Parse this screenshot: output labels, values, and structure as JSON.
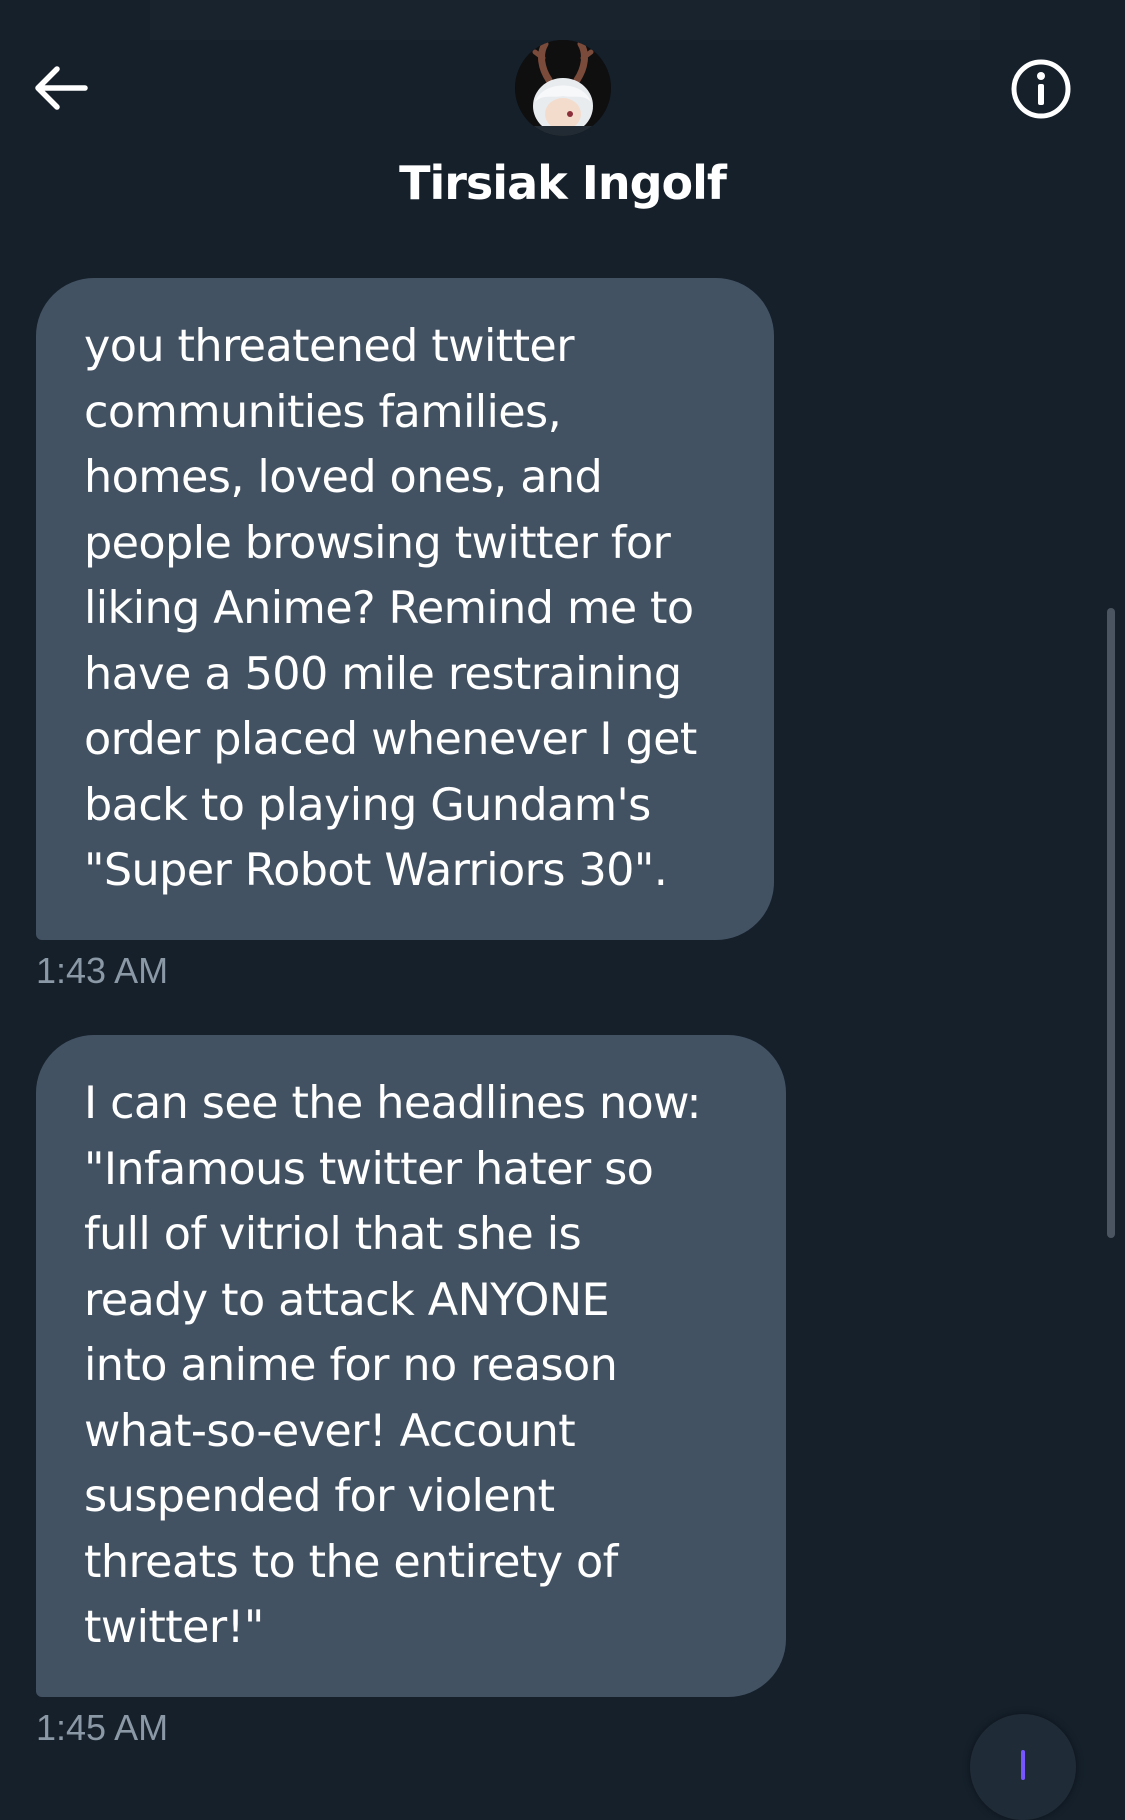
{
  "header": {
    "contact_name": "Tirsiak Ingolf",
    "back_icon": "arrow-left-icon",
    "info_icon": "info-circle-icon",
    "avatar": "anime-character-avatar"
  },
  "messages": [
    {
      "text": "you threatened twitter\ncommunities families,\nhomes, loved ones, and\npeople browsing twitter for\nliking Anime? Remind me to\nhave a 500 mile restraining\norder placed whenever I get\nback to playing Gundam's\n\"Super Robot Warriors 30\".",
      "time": "1:43 AM"
    },
    {
      "text": "I can see the headlines now:\n\"Infamous twitter hater so\nfull of vitriol that she is\nready to attack ANYONE\ninto anime for no reason\nwhat-so-ever! Account\nsuspended for violent\nthreats to the entirety of\ntwitter!\"",
      "time": "1:45 AM"
    }
  ],
  "colors": {
    "background": "#15202b",
    "bubble": "#435262",
    "timestamp": "#8b98a5",
    "accent": "#7856ff"
  }
}
